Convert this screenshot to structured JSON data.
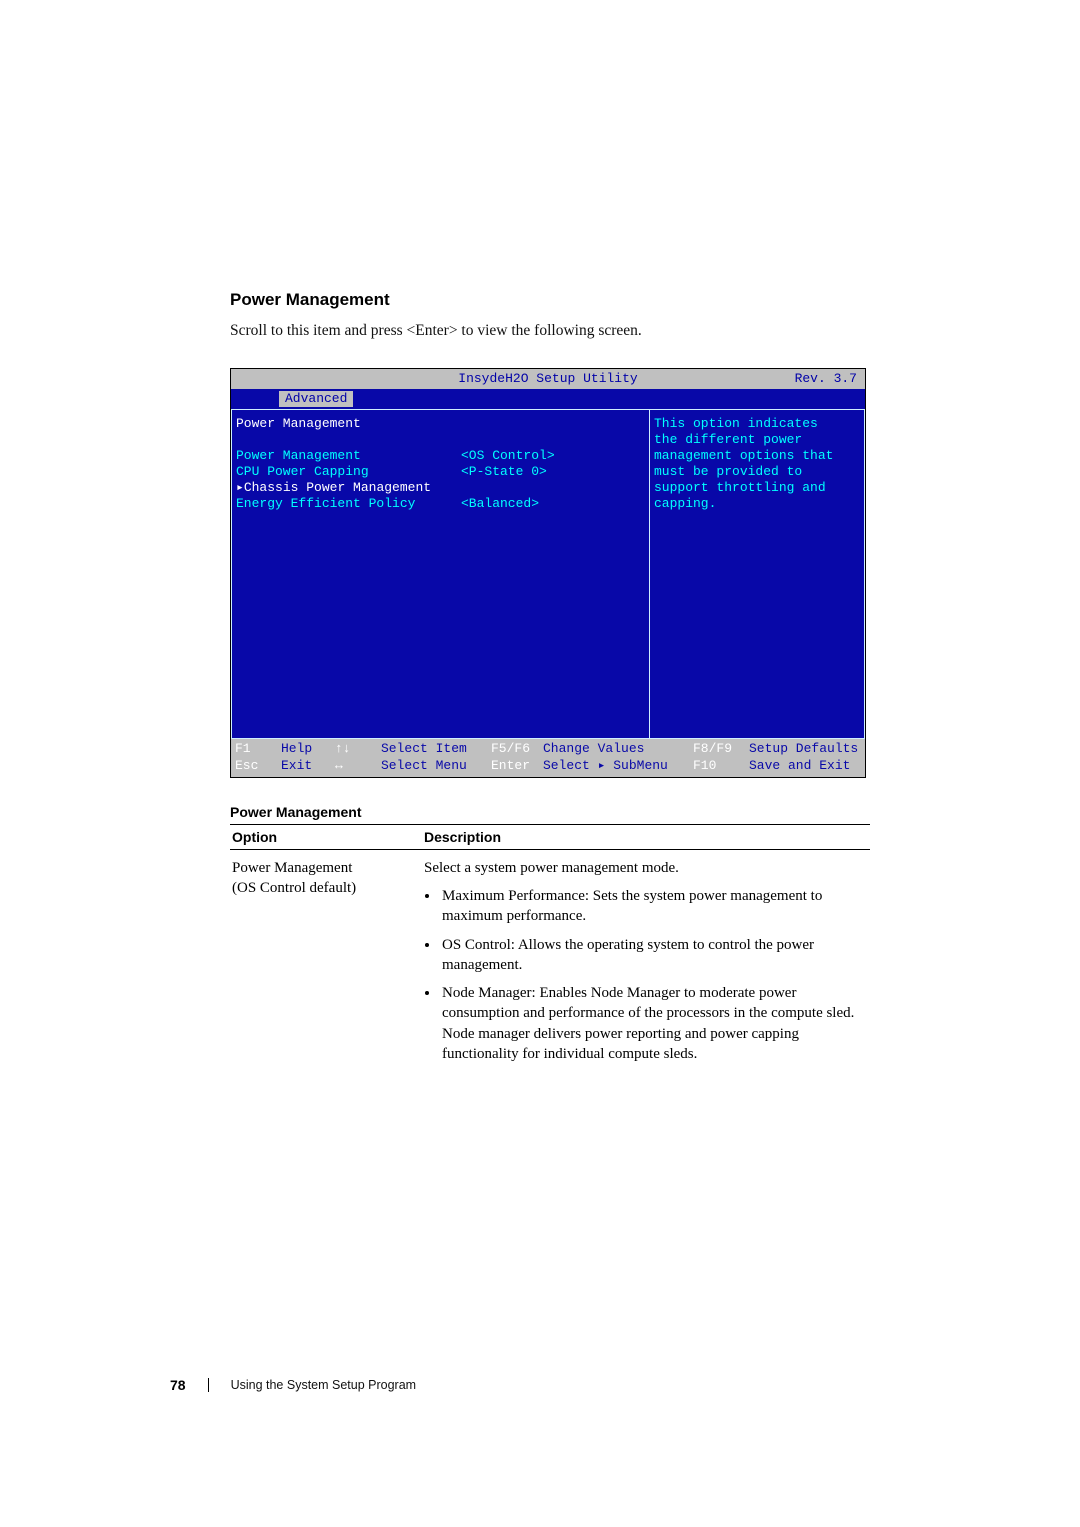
{
  "section": {
    "title": "Power Management",
    "intro": "Scroll to this item and press <Enter> to view the following screen."
  },
  "bios": {
    "header_center": "InsydeH2O Setup Utility",
    "header_right": "Rev. 3.7",
    "tab_active": "Advanced",
    "left": {
      "title": "Power Management",
      "items": [
        "Power Management",
        "CPU Power Capping",
        "Chassis Power Management",
        "Energy Efficient Policy"
      ]
    },
    "mid": {
      "values": [
        "<OS Control>",
        "<P-State 0>",
        "",
        "<Balanced>"
      ]
    },
    "help_lines": [
      "This option indicates",
      "the different power",
      "management options that",
      "must be provided to",
      "support throttling and",
      "capping."
    ],
    "footer": {
      "r1": {
        "k1": "F1",
        "v1": "Help",
        "k2": "↑↓",
        "v2": "Select Item",
        "k3": "F5/F6",
        "v3": "Change Values",
        "k4": "F8/F9",
        "v4": "Setup Defaults"
      },
      "r2": {
        "k1": "Esc",
        "v1": "Exit",
        "k2": "↔",
        "v2": "Select Menu",
        "k3": "Enter",
        "v3": "Select ▸ SubMenu",
        "k4": "F10",
        "v4": "Save and Exit"
      }
    }
  },
  "table": {
    "title": "Power Management",
    "head": {
      "c1": "Option",
      "c2": "Description"
    },
    "row1": {
      "opt_l1": "Power Management",
      "opt_l2": "(OS Control default)",
      "desc_intro": "Select a system power management mode.",
      "b1": "Maximum Performance: Sets the system power management to maximum performance.",
      "b2": "OS Control: Allows the operating system to control the power management.",
      "b3": "Node Manager: Enables Node Manager to moderate power consumption and performance of the processors in the compute sled. Node manager delivers power reporting and power capping functionality for individual compute sleds."
    }
  },
  "footer": {
    "page": "78",
    "text": "Using the System Setup Program"
  }
}
